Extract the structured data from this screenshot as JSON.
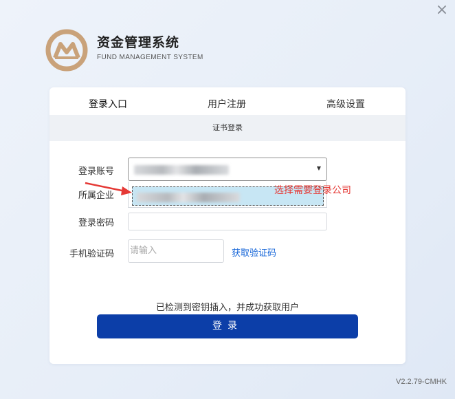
{
  "window": {
    "close_symbol": "×"
  },
  "brand": {
    "title": "资金管理系统",
    "subtitle": "FUND MANAGEMENT SYSTEM",
    "logo_color": "#c9a27a"
  },
  "tabs": [
    {
      "label": "登录入口"
    },
    {
      "label": "用户注册"
    },
    {
      "label": "高级设置"
    }
  ],
  "subbar": {
    "label": "证书登录"
  },
  "form": {
    "account_label": "登录账号",
    "company_label": "所属企业",
    "password_label": "登录密码",
    "code_label": "手机验证码",
    "code_placeholder": "请输入",
    "get_code_label": "获取验证码"
  },
  "status": {
    "text": "已检测到密钥插入，并成功获取用户"
  },
  "login_button": {
    "label": "登录"
  },
  "annotation": {
    "text": "选择需要登录公司",
    "color": "#e53935"
  },
  "version": {
    "text": "V2.2.79-CMHK"
  },
  "colors": {
    "primary": "#0c3ea8",
    "link": "#1565d8",
    "selected_option": "#c7e6f4"
  }
}
